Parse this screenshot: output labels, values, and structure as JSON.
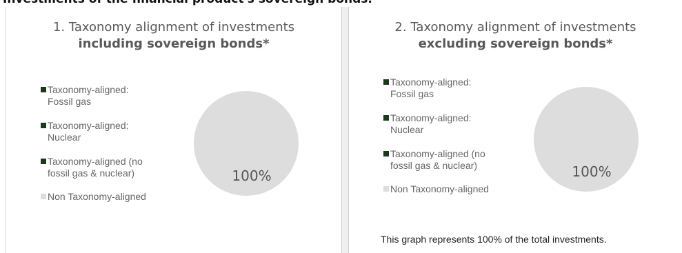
{
  "page_heading": "Investments of the financial product's sovereign bonds.",
  "colors": {
    "fossil_gas": "#1a3a1a",
    "nuclear": "#1a3a1a",
    "other_aligned": "#1a3a1a",
    "non_aligned": "#dddddd",
    "pie_fill": "#dddddd"
  },
  "legend": [
    {
      "label": "Taxonomy-aligned:\nFossil gas",
      "color_key": "fossil_gas"
    },
    {
      "label": "Taxonomy-aligned:\nNuclear",
      "color_key": "nuclear"
    },
    {
      "label": "Taxonomy-aligned (no\nfossil gas & nuclear)",
      "color_key": "other_aligned"
    },
    {
      "label": "Non Taxonomy-aligned",
      "color_key": "non_aligned"
    }
  ],
  "chart_data": [
    {
      "type": "pie",
      "title": "1. Taxonomy alignment of investments",
      "subtitle": "including sovereign bonds*",
      "legend_placement": "left",
      "categories": [
        "Taxonomy-aligned: Fossil gas",
        "Taxonomy-aligned: Nuclear",
        "Taxonomy-aligned (no fossil gas & nuclear)",
        "Non Taxonomy-aligned"
      ],
      "values": [
        0,
        0,
        0,
        100
      ],
      "data_labels": [
        "100%"
      ]
    },
    {
      "type": "pie",
      "title": "2. Taxonomy alignment of investments",
      "subtitle": "excluding sovereign bonds*",
      "legend_placement": "left",
      "categories": [
        "Taxonomy-aligned: Fossil gas",
        "Taxonomy-aligned: Nuclear",
        "Taxonomy-aligned (no fossil gas & nuclear)",
        "Non Taxonomy-aligned"
      ],
      "values": [
        0,
        0,
        0,
        100
      ],
      "data_labels": [
        "100%"
      ]
    }
  ],
  "footnote": "This graph represents 100% of the total investments."
}
